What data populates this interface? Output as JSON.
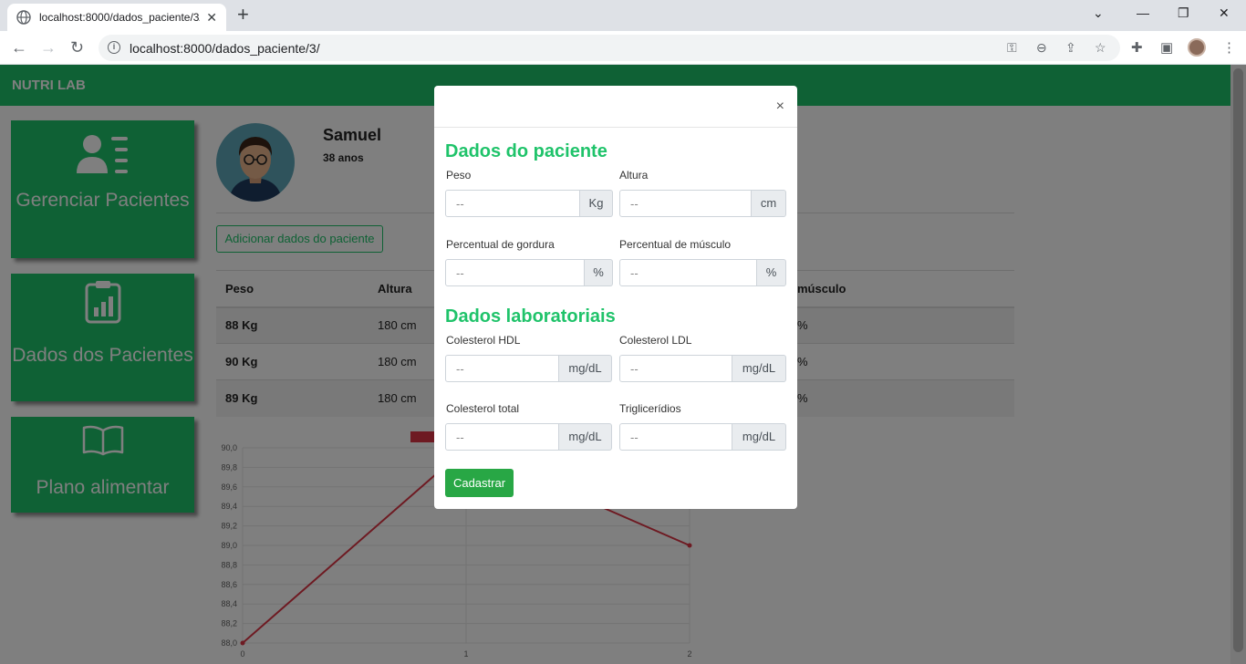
{
  "browser": {
    "tab_title": "localhost:8000/dados_paciente/3/",
    "url": "localhost:8000/dados_paciente/3/"
  },
  "app": {
    "brand": "NUTRI LAB"
  },
  "sidebar": {
    "items": [
      {
        "label": "Gerenciar Pacientes",
        "icon": "users-list-icon"
      },
      {
        "label": "Dados dos Pacientes",
        "icon": "clipboard-chart-icon"
      },
      {
        "label": "Plano alimentar",
        "icon": "book-icon"
      }
    ]
  },
  "patient": {
    "name": "Samuel",
    "age": "38 anos"
  },
  "add_button_label": "Adicionar dados do paciente",
  "table": {
    "headers": {
      "peso": "Peso",
      "altura": "Altura",
      "musculo": "músculo"
    },
    "rows": [
      {
        "peso": "88 Kg",
        "altura": "180 cm",
        "musculo": "%"
      },
      {
        "peso": "90 Kg",
        "altura": "180 cm",
        "musculo": "%"
      },
      {
        "peso": "89 Kg",
        "altura": "180 cm",
        "musculo": "%"
      }
    ]
  },
  "chart_data": {
    "type": "line",
    "x": [
      0,
      1,
      2
    ],
    "series": [
      {
        "values": [
          88.0,
          90.0,
          89.0
        ],
        "color": "#dc3545"
      }
    ],
    "ylim": [
      88.0,
      90.0
    ],
    "yticks": [
      "90,0",
      "89,8",
      "89,6",
      "89,4",
      "89,2",
      "89,0",
      "88,8",
      "88,6",
      "88,4",
      "88,2",
      "88,0"
    ],
    "xticks": [
      "0",
      "1",
      "2"
    ],
    "grid": true
  },
  "modal": {
    "close_label": "×",
    "section1_title": "Dados do paciente",
    "section2_title": "Dados laboratoriais",
    "fields": {
      "peso": {
        "label": "Peso",
        "placeholder": "--",
        "unit": "Kg"
      },
      "altura": {
        "label": "Altura",
        "placeholder": "--",
        "unit": "cm"
      },
      "gordura": {
        "label": "Percentual de gordura",
        "placeholder": "--",
        "unit": "%"
      },
      "musculo": {
        "label": "Percentual de músculo",
        "placeholder": "--",
        "unit": "%"
      },
      "hdl": {
        "label": "Colesterol HDL",
        "placeholder": "--",
        "unit": "mg/dL"
      },
      "ldl": {
        "label": "Colesterol LDL",
        "placeholder": "--",
        "unit": "mg/dL"
      },
      "total": {
        "label": "Colesterol total",
        "placeholder": "--",
        "unit": "mg/dL"
      },
      "trig": {
        "label": "Triglicerídios",
        "placeholder": "--",
        "unit": "mg/dL"
      }
    },
    "submit_label": "Cadastrar"
  },
  "colors": {
    "accent": "#1fc36a",
    "submit": "#28a745",
    "series": "#dc3545"
  }
}
